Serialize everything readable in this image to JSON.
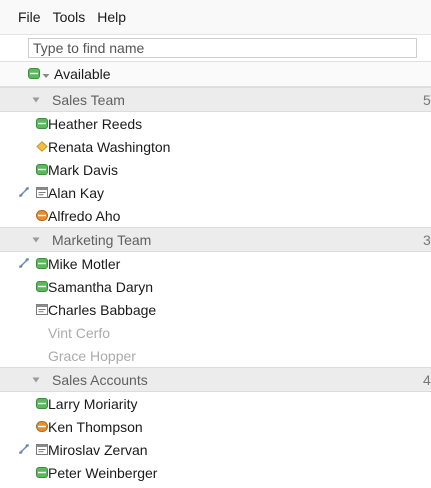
{
  "menu": {
    "file": "File",
    "tools": "Tools",
    "help": "Help"
  },
  "search": {
    "placeholder": "Type to find name"
  },
  "status": {
    "label": "Available"
  },
  "colors": {
    "available": "#5cb85c",
    "away": "#e0a030",
    "busy": "#d9822b",
    "meeting": "#7a7a7a"
  },
  "groups": [
    {
      "name": "Sales Team",
      "count": "5",
      "contacts": [
        {
          "name": "Heather Reeds",
          "status": "available-icon",
          "phone": false
        },
        {
          "name": "Renata Washington",
          "status": "idle-diamond-icon",
          "phone": false
        },
        {
          "name": "Mark Davis",
          "status": "available-icon",
          "phone": false
        },
        {
          "name": "Alan Kay",
          "status": "in-meeting-icon",
          "phone": true
        },
        {
          "name": "Alfredo Aho",
          "status": "busy-icon",
          "phone": false
        }
      ]
    },
    {
      "name": "Marketing Team",
      "count": "3",
      "contacts": [
        {
          "name": "Mike Motler",
          "status": "available-icon",
          "phone": true
        },
        {
          "name": "Samantha Daryn",
          "status": "available-icon",
          "phone": false
        },
        {
          "name": "Charles Babbage",
          "status": "in-meeting-icon",
          "phone": false
        },
        {
          "name": "Vint Cerfo",
          "status": "offline",
          "phone": false
        },
        {
          "name": "Grace Hopper",
          "status": "offline",
          "phone": false
        }
      ]
    },
    {
      "name": "Sales Accounts",
      "count": "4",
      "contacts": [
        {
          "name": "Larry Moriarity",
          "status": "available-icon",
          "phone": false
        },
        {
          "name": "Ken Thompson",
          "status": "busy-icon",
          "phone": false
        },
        {
          "name": "Miroslav Zervan",
          "status": "in-meeting-icon",
          "phone": true
        },
        {
          "name": "Peter Weinberger",
          "status": "available-icon",
          "phone": false
        }
      ]
    }
  ]
}
